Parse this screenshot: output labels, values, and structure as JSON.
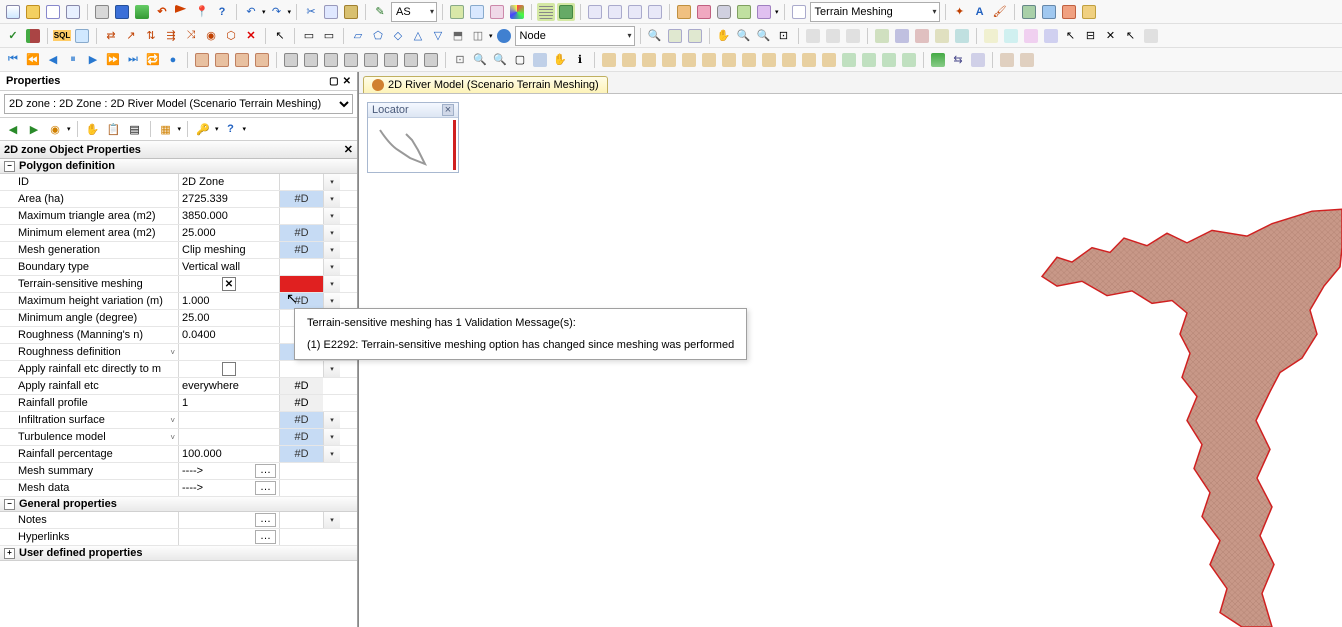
{
  "toolbars": {
    "row1": {
      "dropdown_as": "AS",
      "dropdown_node": "Node",
      "file_dropdown": "Terrain Meshing"
    },
    "row3": {
      "node_label": "Node"
    }
  },
  "panel": {
    "title": "Properties",
    "selector": "2D zone : 2D Zone : 2D River Model (Scenario Terrain Meshing)",
    "sub_header": "2D zone Object Properties"
  },
  "groups": {
    "polygon": "Polygon definition",
    "general": "General properties",
    "user": "User defined properties"
  },
  "props": {
    "id": {
      "label": "ID",
      "value": "2D Zone"
    },
    "area": {
      "label": "Area (ha)",
      "value": "2725.339",
      "flag": "#D"
    },
    "maxtri": {
      "label": "Maximum triangle area (m2)",
      "value": "3850.000"
    },
    "minelem": {
      "label": "Minimum element area (m2)",
      "value": "25.000",
      "flag": "#D"
    },
    "meshgen": {
      "label": "Mesh generation",
      "value": "Clip meshing",
      "flag": "#D"
    },
    "boundary": {
      "label": "Boundary type",
      "value": "Vertical wall"
    },
    "terrain": {
      "label": "Terrain-sensitive meshing"
    },
    "maxheight": {
      "label": "Maximum height variation (m)",
      "value": "1.000",
      "flag": "#D"
    },
    "minangle": {
      "label": "Minimum angle (degree)",
      "value": "25.00"
    },
    "rough": {
      "label": "Roughness (Manning's n)",
      "value": "0.0400"
    },
    "roughdef": {
      "label": "Roughness definition",
      "flag": "#D"
    },
    "applyrain_m": {
      "label": "Apply rainfall etc directly to m"
    },
    "applyrain": {
      "label": "Apply rainfall etc",
      "value": "everywhere",
      "flag": "#D"
    },
    "rainprof": {
      "label": "Rainfall profile",
      "value": "1",
      "flag": "#D"
    },
    "infilt": {
      "label": "Infiltration surface",
      "flag": "#D"
    },
    "turb": {
      "label": "Turbulence model",
      "flag": "#D"
    },
    "rainpct": {
      "label": "Rainfall percentage",
      "value": "100.000",
      "flag": "#D"
    },
    "meshsum": {
      "label": "Mesh summary",
      "value": "---->"
    },
    "meshdata": {
      "label": "Mesh data",
      "value": "---->"
    },
    "notes": {
      "label": "Notes"
    },
    "hyperlinks": {
      "label": "Hyperlinks"
    }
  },
  "viewport": {
    "tab_title": "2D River Model (Scenario Terrain Meshing)"
  },
  "locator": {
    "title": "Locator",
    "close": "×"
  },
  "tooltip": {
    "line1": "Terrain-sensitive meshing has 1 Validation Message(s):",
    "line2": "(1) E2292: Terrain-sensitive meshing option has changed since meshing was performed"
  }
}
